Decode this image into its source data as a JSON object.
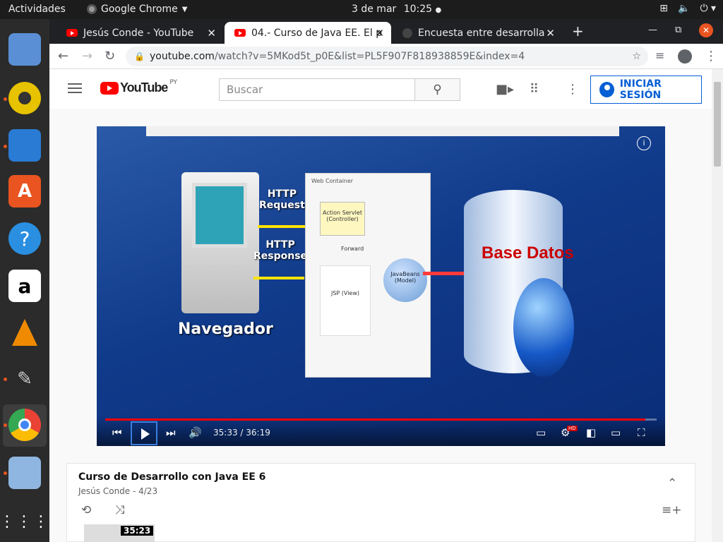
{
  "topbar": {
    "activities": "Actividades",
    "app_name": "Google Chrome",
    "date": "3 de mar",
    "time": "10:25"
  },
  "dock": {
    "items": [
      "file-cabinet-icon",
      "rhythmbox-icon",
      "writer-icon",
      "software-center-icon",
      "help-icon",
      "amazon-icon",
      "vlc-icon",
      "gimp-icon",
      "chrome-icon",
      "virtualbox-icon",
      "apps-grid-icon"
    ]
  },
  "browser": {
    "tabs": [
      {
        "title": "Jesús Conde - YouTube"
      },
      {
        "title": "04.- Curso de Java EE. El p"
      },
      {
        "title": "Encuesta entre desarrolla"
      }
    ],
    "url_host": "youtube.com",
    "url_path": "/watch?v=5MKod5t_p0E&list=PL5F907F818938859E&index=4"
  },
  "youtube": {
    "logo": "YouTube",
    "region": "PY",
    "search_placeholder": "Buscar",
    "signin": "INICIAR SESIÓN"
  },
  "video": {
    "slide": {
      "http_request": "HTTP\nRequest",
      "http_response": "HTTP\nResponse",
      "web_container": "Web Container",
      "action_servlet": "Action Servlet (Controller)",
      "forward": "Forward",
      "jsp": "JSP (View)",
      "javabeans": "JavaBeans (Model)",
      "base_datos": "Base Datos",
      "navegador": "Navegador"
    },
    "current_time": "35:33",
    "duration": "36:19",
    "time_display": "35:33 / 36:19",
    "progress": 0.979,
    "hd_badge": "HD"
  },
  "playlist": {
    "title": "Curso de Desarrollo con Java EE 6",
    "subtitle": "Jesús Conde - 4/23",
    "first_item_duration": "35:23"
  }
}
